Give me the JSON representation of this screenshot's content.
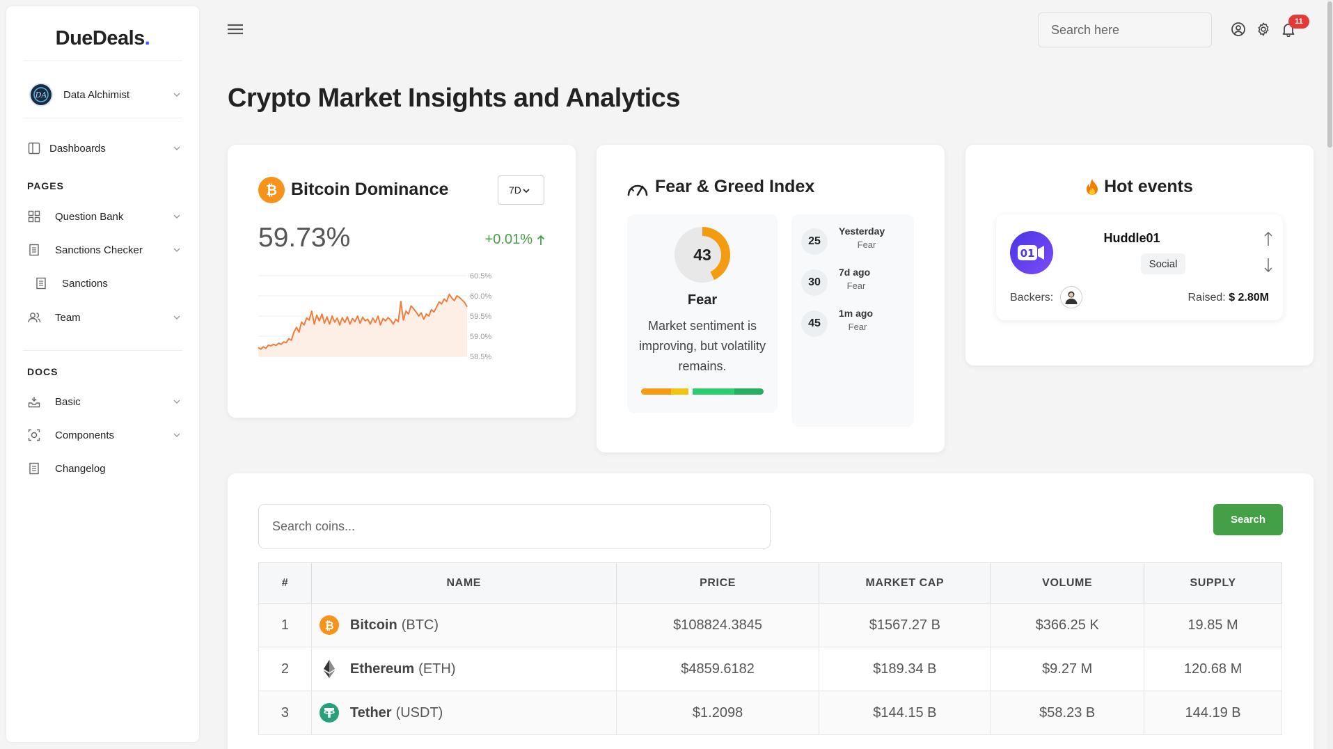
{
  "app": {
    "brand": "DueDeals",
    "brand_dot": "."
  },
  "sidebar": {
    "user_name": "Data Alchimist",
    "items_top": [
      {
        "label": "Dashboards",
        "icon": "layout-icon"
      }
    ],
    "pages_title": "PAGES",
    "pages": [
      {
        "label": "Question Bank",
        "icon": "grid-icon"
      },
      {
        "label": "Sanctions Checker",
        "icon": "document-icon"
      },
      {
        "label": "Sanctions",
        "icon": "document-icon"
      },
      {
        "label": "Team",
        "icon": "users-icon"
      }
    ],
    "docs_title": "DOCS",
    "docs": [
      {
        "label": "Basic",
        "icon": "tray-icon"
      },
      {
        "label": "Components",
        "icon": "components-icon"
      },
      {
        "label": "Changelog",
        "icon": "document-icon"
      }
    ]
  },
  "header": {
    "search_placeholder": "Search here",
    "notification_count": "11"
  },
  "page_title": "Crypto Market Insights and Analytics",
  "dominance": {
    "title": "Bitcoin Dominance",
    "range": "7D",
    "value": "59.73%",
    "change": "+0.01%",
    "colors": {
      "line": "#ef7d3c",
      "fill": "#fdeee6",
      "positive": "#43a047"
    },
    "chart_data": {
      "type": "area",
      "y_tick_labels": [
        "60.5%",
        "60.0%",
        "59.5%",
        "59.0%",
        "58.5%"
      ],
      "ylim": [
        58.5,
        60.5
      ],
      "values": [
        58.72,
        58.68,
        58.74,
        58.7,
        58.78,
        58.76,
        58.8,
        58.77,
        58.83,
        58.8,
        58.86,
        58.84,
        58.94,
        58.9,
        59.1,
        59.22,
        59.1,
        59.35,
        59.28,
        59.45,
        59.4,
        59.62,
        59.3,
        59.52,
        59.38,
        59.55,
        59.32,
        59.48,
        59.3,
        59.5,
        59.35,
        59.45,
        59.28,
        59.46,
        59.34,
        59.48,
        59.3,
        59.44,
        59.36,
        59.5,
        59.32,
        59.47,
        59.38,
        59.42,
        59.3,
        59.45,
        59.34,
        59.5,
        59.28,
        59.44,
        59.38,
        59.46,
        59.4,
        59.3,
        59.42,
        59.36,
        59.86,
        59.4,
        59.62,
        59.55,
        59.75,
        59.68,
        59.6,
        59.5,
        59.58,
        59.42,
        59.55,
        59.5,
        59.66,
        59.6,
        59.72,
        59.85,
        59.8,
        59.92,
        59.86,
        60.04,
        59.95,
        59.88,
        60.0,
        59.96,
        59.9,
        59.84,
        59.73
      ]
    }
  },
  "fear_greed": {
    "title": "Fear & Greed Index",
    "value": "43",
    "value_num": 43,
    "label": "Fear",
    "description": "Market sentiment is improving, but volatility remains.",
    "gauge_colors": [
      "#f39c12",
      "#f1c40f",
      "#2ecc71",
      "#27ae60"
    ],
    "history": [
      {
        "value": "25",
        "when": "Yesterday",
        "label": "Fear"
      },
      {
        "value": "30",
        "when": "7d ago",
        "label": "Fear"
      },
      {
        "value": "45",
        "when": "1m ago",
        "label": "Fear"
      }
    ]
  },
  "hot_events": {
    "title": "Hot events",
    "event": {
      "name": "Huddle01",
      "tag": "Social",
      "backers_label": "Backers:",
      "raised_label": "Raised:",
      "raised_value": "$ 2.80M"
    }
  },
  "coins": {
    "search_placeholder": "Search coins...",
    "search_button": "Search",
    "columns": [
      "#",
      "NAME",
      "PRICE",
      "MARKET CAP",
      "VOLUME",
      "SUPPLY"
    ],
    "rows": [
      {
        "rank": "1",
        "name": "Bitcoin",
        "symbol": "(BTC)",
        "icon": "bitcoin-icon",
        "price": "$108824.3845",
        "market_cap": "$1567.27 B",
        "volume": "$366.25 K",
        "supply": "19.85 M"
      },
      {
        "rank": "2",
        "name": "Ethereum",
        "symbol": "(ETH)",
        "icon": "ethereum-icon",
        "price": "$4859.6182",
        "market_cap": "$189.34 B",
        "volume": "$9.27 M",
        "supply": "120.68 M"
      },
      {
        "rank": "3",
        "name": "Tether",
        "symbol": "(USDT)",
        "icon": "tether-icon",
        "price": "$1.2098",
        "market_cap": "$144.15 B",
        "volume": "$58.23 B",
        "supply": "144.19 B"
      }
    ]
  }
}
